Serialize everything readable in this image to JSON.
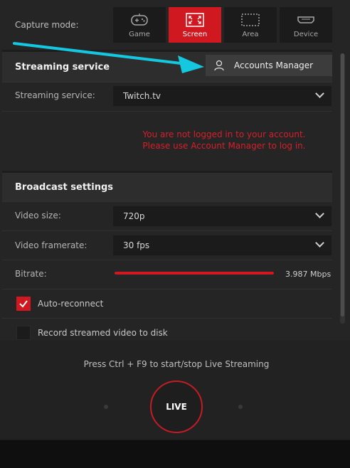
{
  "capture": {
    "label": "Capture mode:",
    "modes": [
      {
        "label": "Game",
        "icon": "gamepad-icon",
        "active": false
      },
      {
        "label": "Screen",
        "icon": "fullscreen-icon",
        "active": true
      },
      {
        "label": "Area",
        "icon": "area-select-icon",
        "active": false
      },
      {
        "label": "Device",
        "icon": "hdmi-icon",
        "active": false
      }
    ]
  },
  "streaming": {
    "section_title": "Streaming service",
    "accounts_button": "Accounts Manager",
    "service_label": "Streaming service:",
    "service_value": "Twitch.tv",
    "error_line1": "You are not logged in to your account.",
    "error_line2": "Please use Account Manager to log in."
  },
  "broadcast": {
    "section_title": "Broadcast settings",
    "video_size_label": "Video size:",
    "video_size_value": "720p",
    "framerate_label": "Video framerate:",
    "framerate_value": "30 fps",
    "bitrate_label": "Bitrate:",
    "bitrate_value": "3.987 Mbps",
    "bitrate_fill": 1.0,
    "auto_reconnect_label": "Auto-reconnect",
    "auto_reconnect_checked": true,
    "record_label": "Record streamed video to disk",
    "record_checked": false
  },
  "live": {
    "hint": "Press Ctrl + F9 to start/stop Live Streaming",
    "button_label": "LIVE"
  },
  "colors": {
    "accent": "#d01820",
    "error": "#d4202a",
    "arrow": "#14c8e0"
  }
}
